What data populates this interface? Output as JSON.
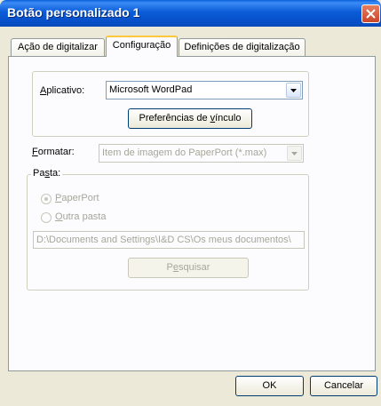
{
  "window": {
    "title": "Botão personalizado 1"
  },
  "tabs": [
    {
      "label": "Ação de digitalizar",
      "active": false
    },
    {
      "label": "Configuração",
      "active": true
    },
    {
      "label": "Definições de digitalização",
      "active": false
    }
  ],
  "settings": {
    "application_label_u": "A",
    "application_label_rest": "plicativo:",
    "application_value": "Microsoft WordPad",
    "link_prefs_pre": "Preferências de ",
    "link_prefs_u": "v",
    "link_prefs_post": "ínculo",
    "format_label_u": "F",
    "format_label_rest": "ormatar:",
    "format_value": "Item de imagem do PaperPort (*.max)",
    "folder_label_pre": "Pa",
    "folder_label_u": "s",
    "folder_label_post": "ta:",
    "radio_paperport_u": "P",
    "radio_paperport_rest": "aperPort",
    "radio_other_u": "O",
    "radio_other_rest": "utra pasta",
    "folder_path": "D:\\Documents and Settings\\I&D CS\\Os meus documentos\\",
    "browse_pre": "P",
    "browse_u": "e",
    "browse_post": "squisar"
  },
  "footer": {
    "ok": "OK",
    "cancel": "Cancelar"
  },
  "colors": {
    "title_bar": "#0a5fdc",
    "close_button": "#c9462c",
    "tab_highlight": "#ffc73c"
  }
}
